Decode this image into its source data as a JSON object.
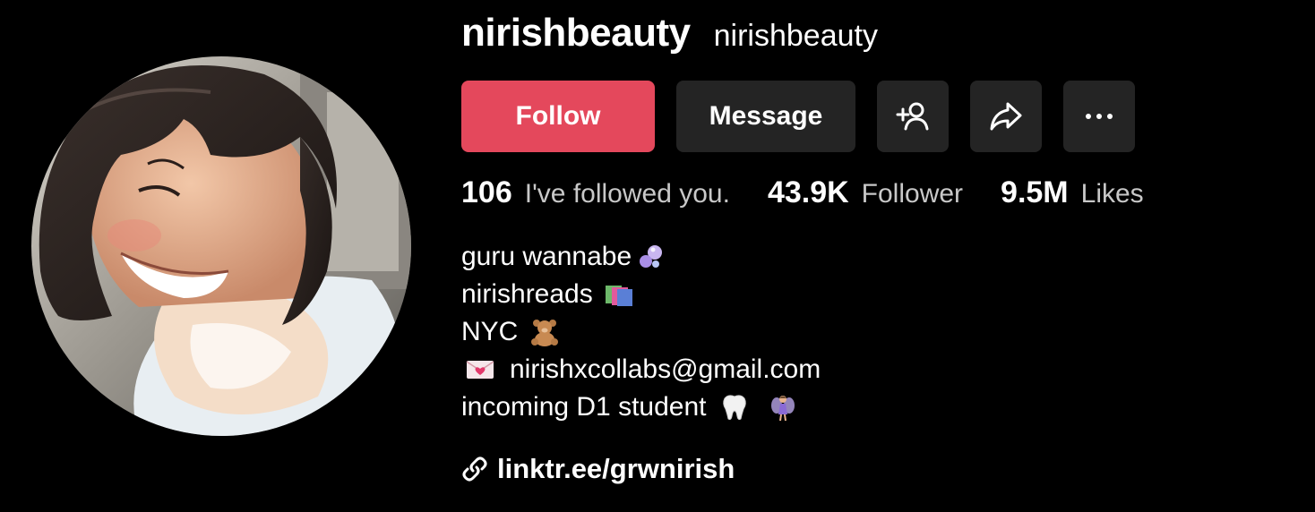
{
  "profile": {
    "username": "nirishbeauty",
    "nickname": "nirishbeauty",
    "avatar_alt": "avatar"
  },
  "actions": {
    "follow_label": "Follow",
    "message_label": "Message",
    "add_friend_icon": "add-friend-icon",
    "share_icon": "share-icon",
    "more_icon": "more-icon"
  },
  "stats": {
    "following_count": "106",
    "following_label": "I've followed you.",
    "followers_count": "43.9K",
    "followers_label": "Follower",
    "likes_count": "9.5M",
    "likes_label": "Likes"
  },
  "bio": {
    "line1": "guru wannabe",
    "line2": "nirishreads",
    "line3": "NYC",
    "line4": "nirishxcollabs@gmail.com",
    "line5": "incoming D1 student"
  },
  "link": {
    "text": "linktr.ee/grwnirish"
  },
  "colors": {
    "background": "#000000",
    "follow_button": "#e4485c",
    "secondary_button": "#242424",
    "muted_text": "#c8c8c8"
  }
}
